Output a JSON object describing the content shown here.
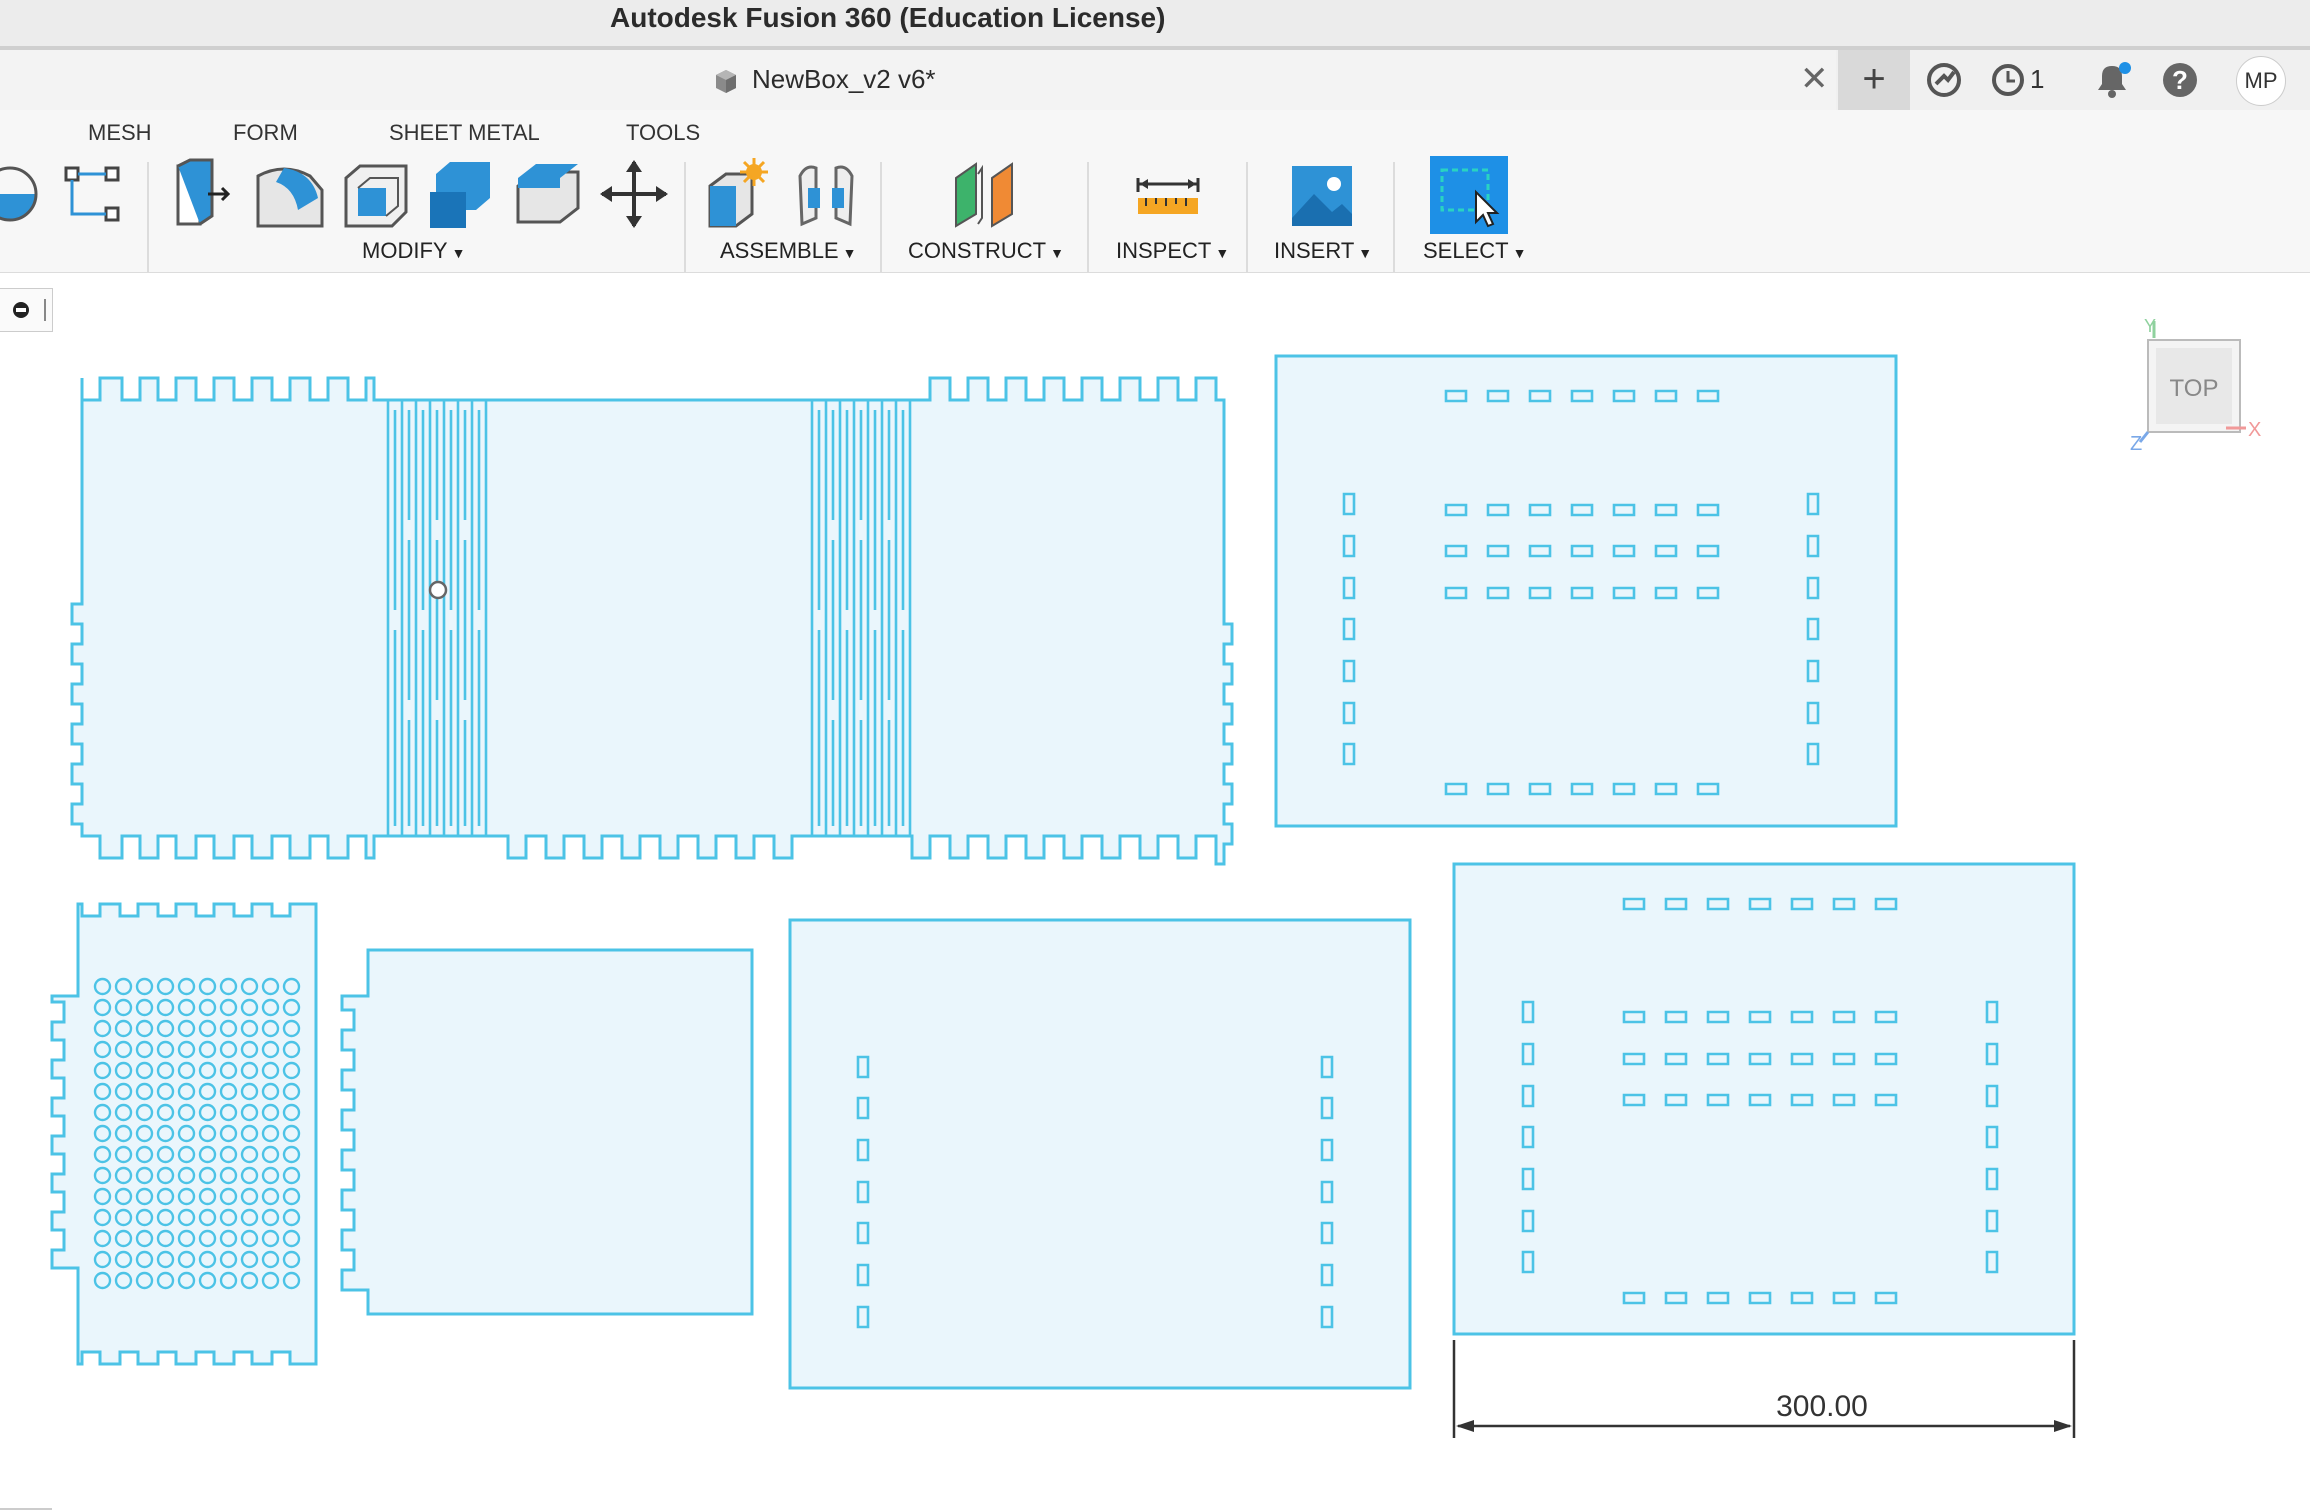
{
  "window": {
    "title": "Autodesk Fusion 360 (Education License)"
  },
  "document_tab": {
    "name": "NewBox_v2 v6*",
    "close_glyph": "✕",
    "new_tab_glyph": "+"
  },
  "header_icons": {
    "data_panel": "extensions-icon",
    "jobs": "clock-icon",
    "jobs_count": "1",
    "notifications": "bell-icon",
    "help": "help-icon",
    "user_initials": "MP"
  },
  "ribbon": {
    "tabs": [
      "MESH",
      "FORM",
      "SHEET METAL",
      "TOOLS"
    ],
    "groups": [
      "MODIFY",
      "ASSEMBLE",
      "CONSTRUCT",
      "INSPECT",
      "INSERT",
      "SELECT"
    ],
    "tools": {
      "create": [
        "revolve-icon",
        "pattern-icon"
      ],
      "modify": [
        "press-pull-icon",
        "fillet-icon",
        "shell-icon",
        "combine-icon",
        "offset-face-icon",
        "move-icon"
      ],
      "assemble": [
        "new-component-icon",
        "joint-icon"
      ],
      "construct": [
        "offset-plane-icon"
      ],
      "inspect": [
        "measure-icon"
      ],
      "insert": [
        "insert-image-icon"
      ],
      "select": [
        "window-select-icon"
      ]
    }
  },
  "viewcube": {
    "face": "TOP",
    "axes": [
      "Y",
      "X",
      "Z"
    ]
  },
  "dimension": {
    "value": "300.00"
  },
  "colors": {
    "sketch_line": "#4cc3e6",
    "sketch_fill": "#eaf6fc",
    "ribbon_blue": "#1e88d6",
    "select_blue": "#1e90e6"
  }
}
